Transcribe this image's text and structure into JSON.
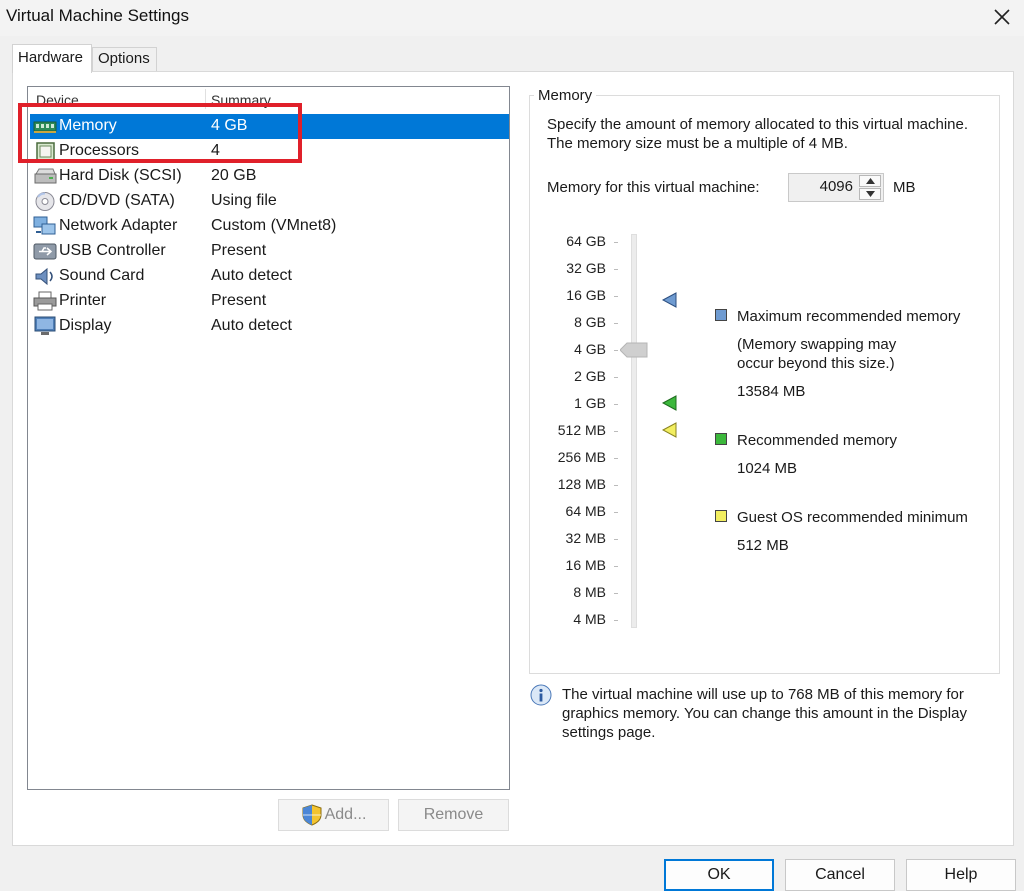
{
  "window": {
    "title": "Virtual Machine Settings",
    "close_icon": "close-icon"
  },
  "tabs": [
    {
      "label": "Hardware",
      "active": true
    },
    {
      "label": "Options",
      "active": false
    }
  ],
  "device_list": {
    "columns": [
      "Device",
      "Summary"
    ],
    "rows": [
      {
        "icon": "memory-icon",
        "device": "Memory",
        "summary": "4 GB",
        "selected": true
      },
      {
        "icon": "processor-icon",
        "device": "Processors",
        "summary": "4"
      },
      {
        "icon": "hard-disk-icon",
        "device": "Hard Disk (SCSI)",
        "summary": "20 GB"
      },
      {
        "icon": "cd-dvd-icon",
        "device": "CD/DVD (SATA)",
        "summary": "Using file"
      },
      {
        "icon": "network-adapter-icon",
        "device": "Network Adapter",
        "summary": "Custom (VMnet8)"
      },
      {
        "icon": "usb-icon",
        "device": "USB Controller",
        "summary": "Present"
      },
      {
        "icon": "sound-card-icon",
        "device": "Sound Card",
        "summary": "Auto detect"
      },
      {
        "icon": "printer-icon",
        "device": "Printer",
        "summary": "Present"
      },
      {
        "icon": "display-icon",
        "device": "Display",
        "summary": "Auto detect"
      }
    ]
  },
  "list_buttons": {
    "add": "Add...",
    "remove": "Remove"
  },
  "memory": {
    "group_title": "Memory",
    "description": "Specify the amount of memory allocated to this virtual machine. The memory size must be a multiple of 4 MB.",
    "field_label": "Memory for this virtual machine:",
    "value": "4096",
    "unit": "MB",
    "scale_labels": [
      "64 GB",
      "32 GB",
      "16 GB",
      "8 GB",
      "4 GB",
      "2 GB",
      "1 GB",
      "512 MB",
      "256 MB",
      "128 MB",
      "64 MB",
      "32 MB",
      "16 MB",
      "8 MB",
      "4 MB"
    ],
    "slider_level": "4 GB",
    "legend": {
      "max": {
        "title": "Maximum recommended memory",
        "note": "(Memory swapping may occur beyond this size.)",
        "note_line1": "(Memory swapping may",
        "note_line2": "occur beyond this size.)",
        "value": "13584 MB",
        "color": "#6f9bd1"
      },
      "recommended": {
        "title": "Recommended memory",
        "value": "1024 MB",
        "color": "#3cb83c"
      },
      "guest_min": {
        "title": "Guest OS recommended minimum",
        "value": "512 MB",
        "color": "#f2ee60"
      }
    }
  },
  "info": {
    "text_line1": "The virtual machine will use up to 768 MB of this memory for",
    "text_line2": "graphics memory. You can change this amount in the Display",
    "text_line3": "settings page."
  },
  "footer_buttons": {
    "ok": "OK",
    "cancel": "Cancel",
    "help": "Help"
  }
}
